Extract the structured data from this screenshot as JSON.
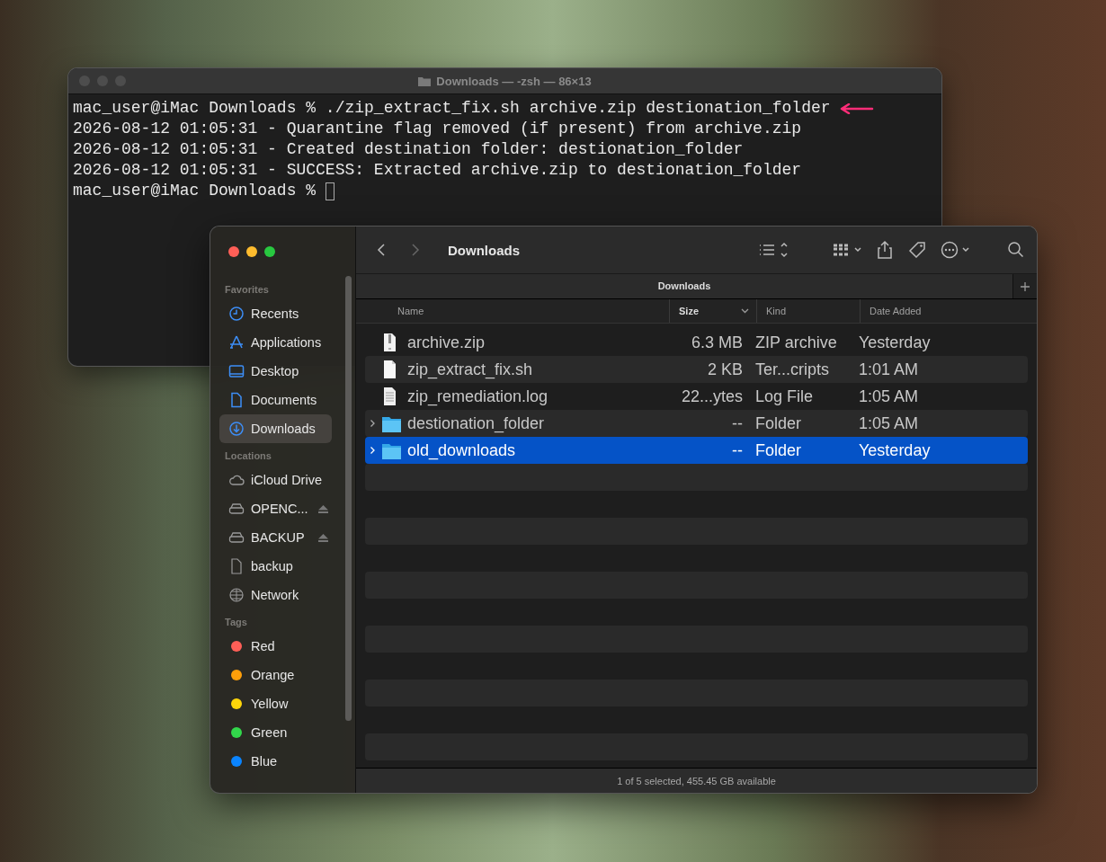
{
  "terminal": {
    "title": "Downloads — -zsh — 86×13",
    "lines": [
      {
        "kind": "command",
        "text": "mac_user@iMac Downloads % ./zip_extract_fix.sh archive.zip destionation_folder",
        "marked": true
      },
      {
        "kind": "output",
        "text": "2026-08-12 01:05:31 - Quarantine flag removed (if present) from archive.zip",
        "marked": false
      },
      {
        "kind": "output",
        "text": "2026-08-12 01:05:31 - Created destination folder: destionation_folder",
        "marked": false
      },
      {
        "kind": "output",
        "text": "2026-08-12 01:05:31 - SUCCESS: Extracted archive.zip to destionation_folder",
        "marked": false
      },
      {
        "kind": "prompt",
        "text": "mac_user@iMac Downloads %",
        "marked": false
      }
    ]
  },
  "finder": {
    "title": "Downloads",
    "tab": "Downloads",
    "sidebar": [
      {
        "heading": "Favorites",
        "items": [
          {
            "label": "Recents",
            "kind": "clock",
            "selected": false
          },
          {
            "label": "Applications",
            "kind": "apps",
            "selected": false
          },
          {
            "label": "Desktop",
            "kind": "desktop",
            "selected": false
          },
          {
            "label": "Documents",
            "kind": "document",
            "selected": false
          },
          {
            "label": "Downloads",
            "kind": "download",
            "selected": true
          }
        ]
      },
      {
        "heading": "Locations",
        "items": [
          {
            "label": "iCloud Drive",
            "kind": "cloud",
            "selected": false
          },
          {
            "label": "OPENC...",
            "kind": "drive",
            "selected": false
          },
          {
            "label": "BACKUP",
            "kind": "drive",
            "selected": false
          },
          {
            "label": "backup",
            "kind": "file",
            "selected": false
          },
          {
            "label": "Network",
            "kind": "network",
            "selected": false
          }
        ]
      },
      {
        "heading": "Tags",
        "items": [
          {
            "label": "Red",
            "kind": "tag",
            "color": "#ff5f57",
            "selected": false
          },
          {
            "label": "Orange",
            "kind": "tag",
            "color": "#ff9f0a",
            "selected": false
          },
          {
            "label": "Yellow",
            "kind": "tag",
            "color": "#ffd60a",
            "selected": false
          },
          {
            "label": "Green",
            "kind": "tag",
            "color": "#32d74b",
            "selected": false
          },
          {
            "label": "Blue",
            "kind": "tag",
            "color": "#0a84ff",
            "selected": false
          }
        ]
      }
    ],
    "columns": [
      {
        "label": "Name",
        "sorted": false
      },
      {
        "label": "Size",
        "sorted": true
      },
      {
        "label": "Kind",
        "sorted": false
      },
      {
        "label": "Date Added",
        "sorted": false
      }
    ],
    "rows": [
      {
        "kind": "zip",
        "name": "archive.zip",
        "size": "6.3 MB",
        "type": "ZIP archive",
        "date": "Yesterday",
        "expandable": false,
        "selected": false
      },
      {
        "kind": "script",
        "name": "zip_extract_fix.sh",
        "size": "2 KB",
        "type": "Ter...cripts",
        "date": "1:01 AM",
        "expandable": false,
        "selected": false
      },
      {
        "kind": "log",
        "name": "zip_remediation.log",
        "size": "22...ytes",
        "type": "Log File",
        "date": "1:05 AM",
        "expandable": false,
        "selected": false
      },
      {
        "kind": "folder",
        "name": "destionation_folder",
        "size": "--",
        "type": "Folder",
        "date": "1:05 AM",
        "expandable": true,
        "selected": false
      },
      {
        "kind": "folder",
        "name": "old_downloads",
        "size": "--",
        "type": "Folder",
        "date": "Yesterday",
        "expandable": true,
        "selected": true
      }
    ],
    "status_bar": "1 of 5 selected, 455.45 GB available"
  }
}
